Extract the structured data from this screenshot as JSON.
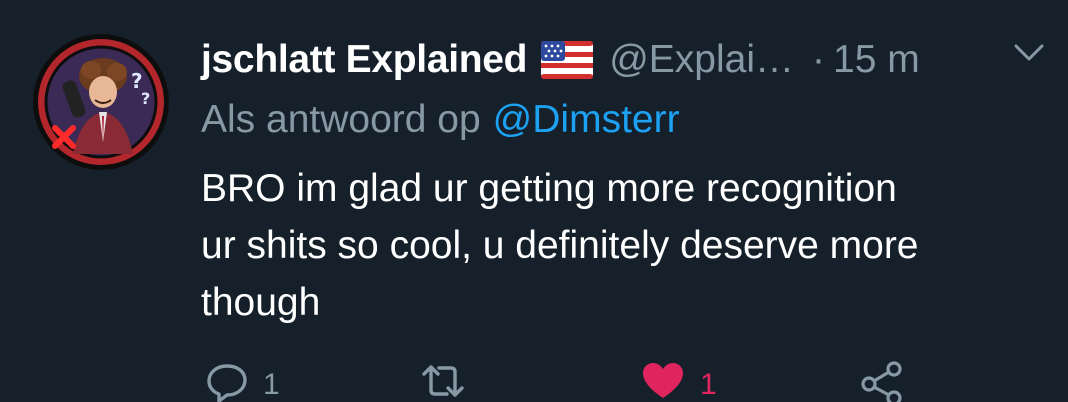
{
  "tweet": {
    "display_name": "jschlatt Explained",
    "flag_icon": "us-flag-icon",
    "handle": "@Explai…",
    "separator": "·",
    "timestamp": "15 m",
    "reply_prefix": "Als antwoord op",
    "reply_target": "@Dimsterr",
    "body_lines": [
      "BRO im glad ur getting more recognition",
      "ur shits so cool, u definitely deserve more",
      "though"
    ]
  },
  "actions": {
    "reply_count": "1",
    "like_count": "1",
    "liked": true
  },
  "colors": {
    "background": "#15202b",
    "text": "#ffffff",
    "secondary": "#8899a6",
    "link": "#1da1f2",
    "like": "#e0245e"
  }
}
